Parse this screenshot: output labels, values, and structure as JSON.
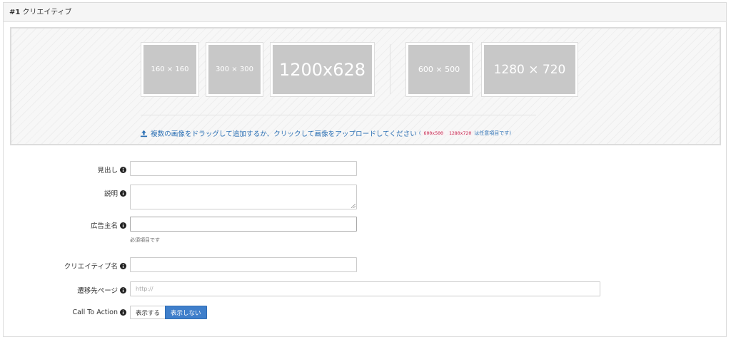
{
  "panel": {
    "number": "#1",
    "title": "クリエイティブ"
  },
  "thumbnails": [
    {
      "label": "160 × 160"
    },
    {
      "label": "300 × 300"
    },
    {
      "label": "1200x628"
    },
    {
      "label": "600 × 500"
    },
    {
      "label": "1280 × 720"
    }
  ],
  "upload": {
    "text": "複数の画像をドラッグして追加するか、クリックして画像をアップロードしてください",
    "paren_open": "(",
    "optional_size_1": "600x500",
    "optional_size_2": "1280x720",
    "optional_note": "は任意項目です)"
  },
  "form": {
    "headline": {
      "label": "見出し",
      "value": ""
    },
    "description": {
      "label": "説明",
      "value": ""
    },
    "advertiser": {
      "label": "広告主名",
      "value": "",
      "help": "必須項目です"
    },
    "creative_name": {
      "label": "クリエイティブ名",
      "value": ""
    },
    "destination": {
      "label": "遷移先ページ",
      "value": "",
      "placeholder": "http://"
    },
    "cta": {
      "label": "Call To Action",
      "show_label": "表示する",
      "hide_label": "表示しない",
      "selected": "表示しない"
    }
  },
  "colors": {
    "accent": "#3f7fcb",
    "link": "#2a6fb4",
    "placeholder_bg": "#c8c8c8"
  },
  "icons": {
    "upload": "upload-icon",
    "info": "info-circle-icon",
    "resize": "resize-grip-icon"
  }
}
